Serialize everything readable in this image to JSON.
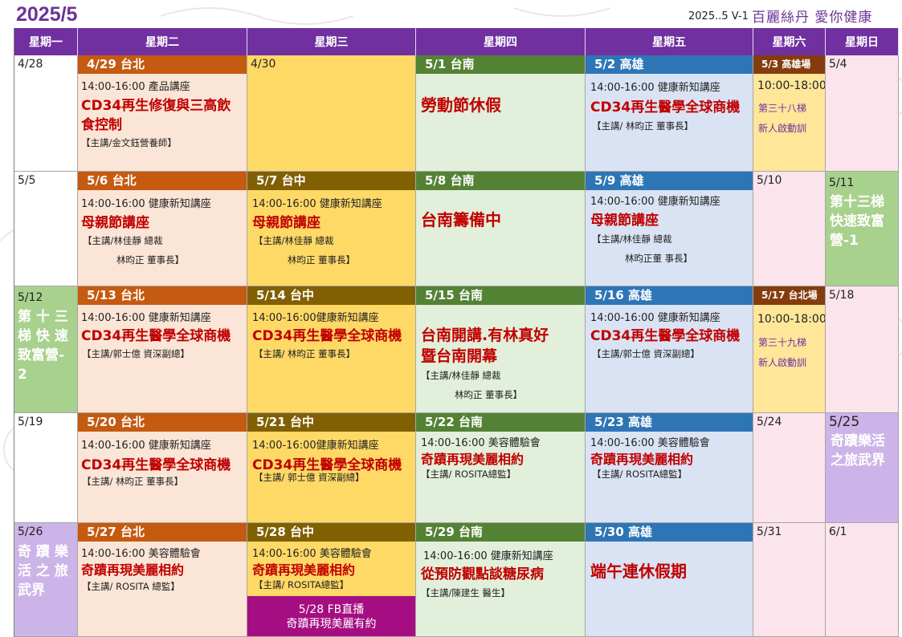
{
  "page_title": "2025/5",
  "version": "2025..5 V-1",
  "brand": "百麗絲丹  愛你健康",
  "weekdays": [
    "星期一",
    "星期二",
    "星期三",
    "星期四",
    "星期五",
    "星期六",
    "星期日"
  ],
  "colors": {
    "header": "#7030a0",
    "taipei": "#c55a11",
    "taichung": "#806000",
    "tainan": "#548235",
    "kaohsiung": "#2e75b6",
    "highlight": "#a50e82"
  },
  "week1": {
    "mon": {
      "date": "4/28"
    },
    "tue": {
      "band": "4/29 台北",
      "time": "14:00-16:00 產品講座",
      "title1": "CD34再生修復與三高飲",
      "title2": "食控制",
      "teacher": "【主講/金文鈺營養師】"
    },
    "wed": {
      "date": "4/30"
    },
    "thu": {
      "band": "5/1 台南",
      "title": "勞動節休假"
    },
    "fri": {
      "band": "5/2 高雄",
      "time": "14:00-16:00 健康新知講座",
      "title": "CD34再生醫學全球商機",
      "teacher": "【主講/ 林昀正 董事長】"
    },
    "sat": {
      "band": "5/3 高雄場",
      "time": "10:00-18:00",
      "line1": "第三十八梯",
      "line2": "新人啟動訓"
    },
    "sun": {
      "date": "5/4"
    }
  },
  "week2": {
    "mon": {
      "date": "5/5"
    },
    "tue": {
      "band": "5/6 台北",
      "time": "14:00-16:00 健康新知講座",
      "title": "母親節講座",
      "teacher1": "【主講/林佳靜 總裁",
      "teacher2": "林昀正 董事長】"
    },
    "wed": {
      "band": "5/7 台中",
      "time": "14:00-16:00 健康新知講座",
      "title": "母親節講座",
      "teacher1": "【主講/林佳靜 總裁",
      "teacher2": "林昀正 董事長】"
    },
    "thu": {
      "band": "5/8 台南",
      "title": "台南籌備中"
    },
    "fri": {
      "band": "5/9 高雄",
      "time": "14:00-16:00 健康新知講座",
      "title": "母親節講座",
      "teacher1": "【主講/林佳靜 總裁",
      "teacher2": "林昀正董 事長】"
    },
    "sat": {
      "date": "5/10"
    },
    "sun": {
      "date": "5/11",
      "l1": "第十三梯",
      "l2": "快速致富",
      "l3": "營-1"
    }
  },
  "week3": {
    "mon": {
      "date": "5/12",
      "l1": "第 十 三",
      "l2": "梯 快 速",
      "l3": "致富營-",
      "l4": "2"
    },
    "tue": {
      "band": "5/13 台北",
      "time": "14:00-16:00 健康新知講座",
      "title": "CD34再生醫學全球商機",
      "teacher": "【主講/郭士億 資深副總】"
    },
    "wed": {
      "band": "5/14 台中",
      "time": "14:00-16:00健康新知講座",
      "title": "CD34再生醫學全球商機",
      "teacher": "【主講/ 林昀正 董事長】"
    },
    "thu": {
      "band": "5/15 台南",
      "title1": "台南開講.有林真好",
      "title2": "暨台南開幕",
      "teacher1": "【主講/林佳靜 總裁",
      "teacher2": "林昀正 董事長】"
    },
    "fri": {
      "band": "5/16 高雄",
      "time": "14:00-16:00 健康新知講座",
      "title": "CD34再生醫學全球商機",
      "teacher": "【主講/郭士億 資深副總】"
    },
    "sat": {
      "band": "5/17 台北場",
      "time": "10:00-18:00",
      "line1": "第三十九梯",
      "line2": "新人啟動訓"
    },
    "sun": {
      "date": "5/18"
    }
  },
  "week4": {
    "mon": {
      "date": "5/19"
    },
    "tue": {
      "band": "5/20 台北",
      "time": "14:00-16:00 健康新知講座",
      "title": "CD34再生醫學全球商機",
      "teacher": "【主講/ 林昀正 董事長】"
    },
    "wed": {
      "band": "5/21 台中",
      "time": "14:00-16:00健康新知講座",
      "title": "CD34再生醫學全球商機",
      "teacher": "【主講/ 郭士億 資深副總】"
    },
    "thu": {
      "band": "5/22 台南",
      "time": "14:00-16:00 美容體驗會",
      "title": "奇蹟再現美麗相約",
      "teacher": "【主講/  ROSITA總監】"
    },
    "fri": {
      "band": "5/23 高雄",
      "time": "14:00-16:00 美容體驗會",
      "title": "奇蹟再現美麗相約",
      "teacher": "【主講/ ROSITA總監】"
    },
    "sat": {
      "date": "5/24"
    },
    "sun": {
      "date": "5/25",
      "l1": "奇蹟樂活",
      "l2": "之旅武界"
    }
  },
  "week5": {
    "mon": {
      "date": "5/26",
      "l1": "奇 蹟 樂",
      "l2": "活 之 旅",
      "l3": "武界"
    },
    "tue": {
      "band": "5/27 台北",
      "time": "14:00-16:00 美容體驗會",
      "title": "奇蹟再現美麗相約",
      "teacher": "【主講/ ROSITA 總監】"
    },
    "wed": {
      "band": "5/28 台中",
      "time": "14:00-16:00 美容體驗會",
      "title": "奇蹟再現美麗相約",
      "teacher": "【主講/  ROSITA總監】",
      "fb1": "5/28 FB直播",
      "fb2": "奇蹟再現美麗有約"
    },
    "thu": {
      "band": "5/29 台南",
      "time": "14:00-16:00 健康新知講座",
      "title": "從預防觀點談糖尿病",
      "teacher": "【主講/陳建生 醫生】"
    },
    "fri": {
      "band": "5/30 高雄",
      "title": "端午連休假期"
    },
    "sat": {
      "date": "5/31"
    },
    "sun": {
      "date": "6/1"
    }
  }
}
